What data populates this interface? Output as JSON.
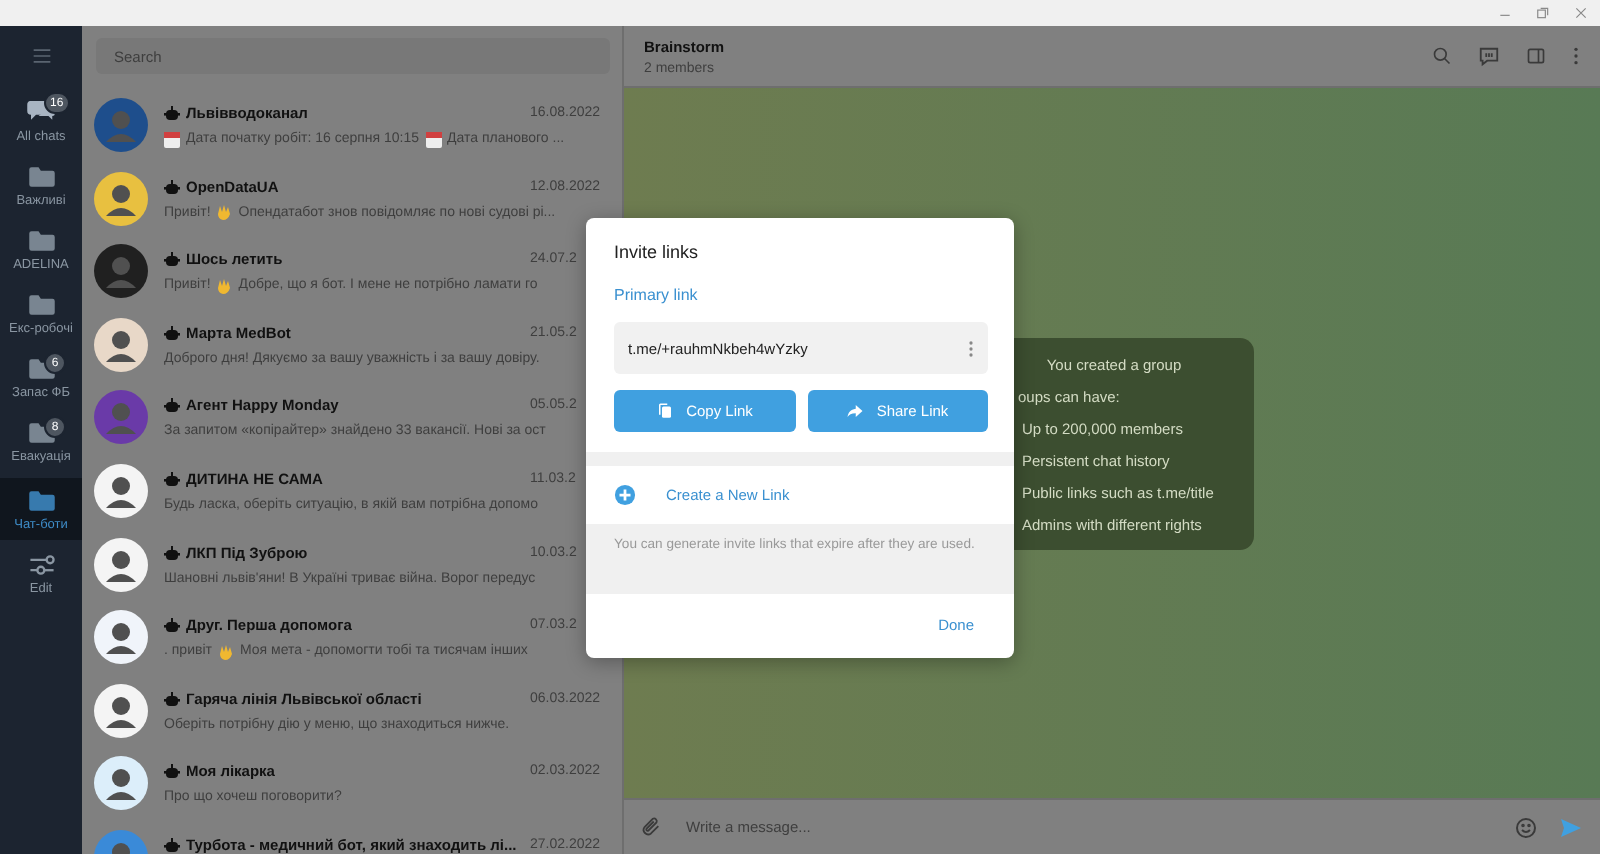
{
  "sidebar": {
    "folders": [
      {
        "label": "All chats",
        "badge": "16",
        "kind": "chats",
        "selected": false
      },
      {
        "label": "Важливі",
        "kind": "folder",
        "selected": false
      },
      {
        "label": "ADELINA",
        "kind": "folder",
        "selected": false
      },
      {
        "label": "Екс-робочі",
        "kind": "folder",
        "selected": false
      },
      {
        "label": "Запас ФБ",
        "badge": "6",
        "kind": "folder",
        "selected": false
      },
      {
        "label": "Евакуація",
        "badge": "8",
        "kind": "folder",
        "selected": false
      },
      {
        "label": "Чат-боти",
        "kind": "folder",
        "selected": true
      },
      {
        "label": "Edit",
        "kind": "edit",
        "selected": false
      }
    ]
  },
  "chat_list": {
    "search": {
      "placeholder": "Search"
    },
    "chats": [
      {
        "name": "Львівводоканал",
        "date": "16.08.2022",
        "color": "#1e4e8c",
        "message": [
          {
            "kind": "calendar"
          },
          {
            "kind": "text",
            "text": "Дата початку робіт: 16 серпня 10:15"
          },
          {
            "kind": "calendar"
          },
          {
            "kind": "text",
            "text": "Дата планового ..."
          }
        ]
      },
      {
        "name": "OpenDataUA",
        "date": "12.08.2022",
        "color": "#e8c040",
        "message": [
          {
            "kind": "text",
            "text": "Привіт!"
          },
          {
            "kind": "wave"
          },
          {
            "kind": "text",
            "text": "Опендатабот знов повідомляє по нові судові рі..."
          }
        ]
      },
      {
        "name": "Шось летить",
        "date": "24.07.2",
        "color": "#202020",
        "message": [
          {
            "kind": "text",
            "text": "Привіт!"
          },
          {
            "kind": "wave"
          },
          {
            "kind": "text",
            "text": "Добре, що я бот. І мене не потрібно ламати го"
          }
        ]
      },
      {
        "name": "Марта MedBot",
        "date": "21.05.2",
        "color": "#e8d8c8",
        "message": [
          {
            "kind": "text",
            "text": "Доброго дня! Дякуємо за вашу уважність і за вашу довіру."
          }
        ]
      },
      {
        "name": "Агент Happy Monday",
        "date": "05.05.2",
        "color": "#6a3aa8",
        "message": [
          {
            "kind": "text",
            "text": "За запитом «копірайтер» знайдено 33 вакансії.  Нові за ост"
          }
        ]
      },
      {
        "name": "ДИТИНА НЕ САМА",
        "date": "11.03.2",
        "color": "#f4f4f4",
        "message": [
          {
            "kind": "text",
            "text": "Будь ласка, оберіть ситуацію, в якій вам потрібна допомо"
          }
        ]
      },
      {
        "name": "ЛКП Під Зуброю",
        "date": "10.03.2",
        "color": "#f4f4f4",
        "message": [
          {
            "kind": "text",
            "text": "Шановні львів'яни!  В Україні триває війна. Ворог передус"
          }
        ]
      },
      {
        "name": "Друг. Перша допомога",
        "date": "07.03.2",
        "color": "#f0f4fa",
        "message": [
          {
            "kind": "text",
            "text": ". привіт"
          },
          {
            "kind": "wave"
          },
          {
            "kind": "text",
            "text": "Моя мета - допомогти тобі та тисячам інших"
          }
        ]
      },
      {
        "name": "Гаряча лінія Львівської області",
        "date": "06.03.2022",
        "color": "#f4f4f4",
        "message": [
          {
            "kind": "text",
            "text": "Оберіть потрібну дію у меню, що знаходиться нижче."
          }
        ]
      },
      {
        "name": "Моя лікарка",
        "date": "02.03.2022",
        "color": "#dceefa",
        "message": [
          {
            "kind": "text",
            "text": "Про що хочеш поговорити?"
          }
        ]
      },
      {
        "name": "Турбота - медичний бот, який знаходить лі...",
        "date": "27.02.2022",
        "color": "#3a8ad8"
      }
    ]
  },
  "chat": {
    "title": "Brainstorm",
    "subtitle": "2 members",
    "service_card": {
      "heading": "You created a group",
      "list_title": "oups can have:",
      "items": [
        "Up to 200,000 members",
        "Persistent chat history",
        "Public links such as t.me/title",
        "Admins with different rights"
      ]
    },
    "composer": {
      "placeholder": "Write a message..."
    }
  },
  "dialog": {
    "title": "Invite links",
    "section": "Primary link",
    "link": "t.me/+rauhmNkbeh4wYzky",
    "buttons": [
      {
        "label": "Copy Link",
        "kind": "copy"
      },
      {
        "label": "Share Link",
        "kind": "share"
      }
    ],
    "create": "Create a New Link",
    "note": "You can generate invite links that expire after they are used.",
    "done": "Done"
  }
}
